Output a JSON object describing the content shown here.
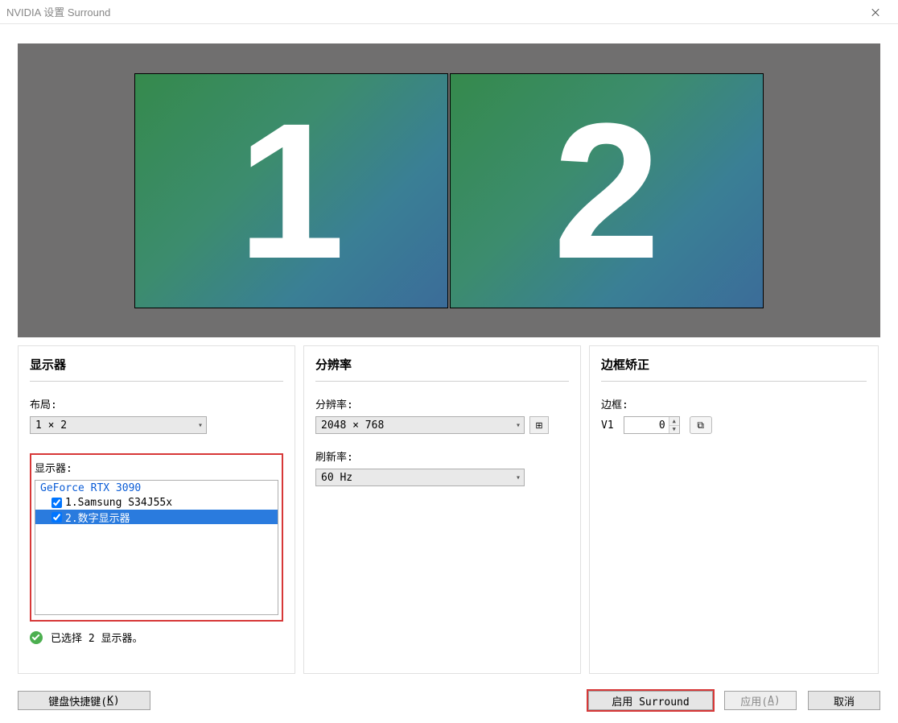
{
  "window": {
    "title": "NVIDIA 设置 Surround"
  },
  "preview": {
    "monitors": [
      {
        "label": "1"
      },
      {
        "label": "2"
      }
    ]
  },
  "displaysPanel": {
    "header": "显示器",
    "layoutLabel": "布局:",
    "layoutValue": "1 × 2",
    "listLabel": "显示器:",
    "gpuName": "GeForce RTX 3090",
    "items": [
      {
        "label": "1.Samsung S34J55x",
        "checked": true,
        "selected": false
      },
      {
        "label": "2.数字显示器",
        "checked": true,
        "selected": true
      }
    ],
    "statusText": "已选择 2 显示器。"
  },
  "resolutionPanel": {
    "header": "分辨率",
    "resLabel": "分辨率:",
    "resValue": "2048 × 768",
    "refreshLabel": "刷新率:",
    "refreshValue": "60 Hz"
  },
  "bezelPanel": {
    "header": "边框矫正",
    "bezelLabel": "边框:",
    "bezelName": "V1",
    "bezelValue": "0"
  },
  "footer": {
    "keyboardLabel": "键盘快捷键(",
    "keyboardKey": "K",
    "keyboardClose": ")",
    "enableLabel": "启用 Surround",
    "applyLabel": "应用(",
    "applyKey": "A",
    "applyClose": ")",
    "cancelLabel": "取消"
  }
}
